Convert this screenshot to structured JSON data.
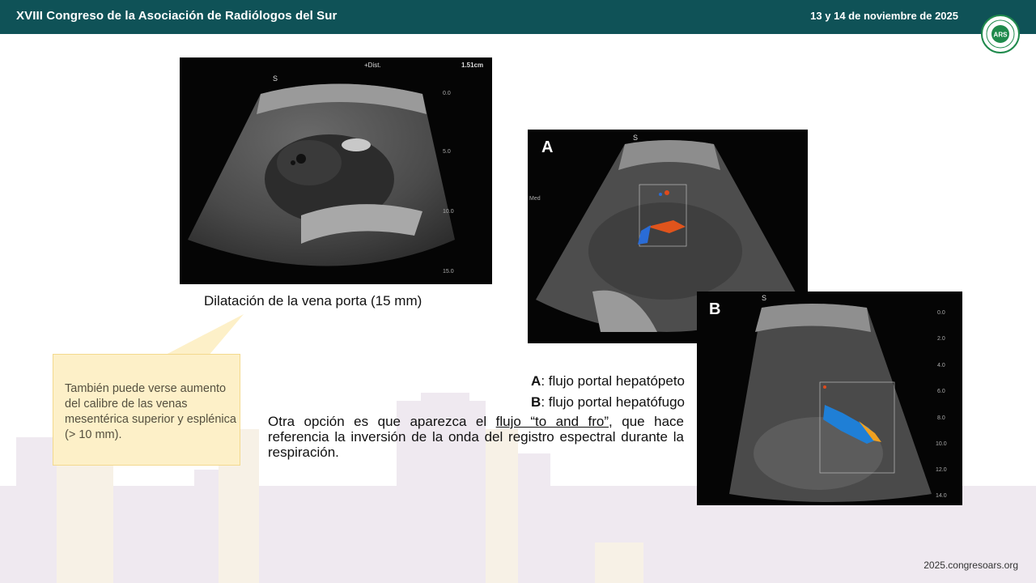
{
  "header": {
    "title": "XVIII Congreso de la Asociación de Radiólogos del Sur",
    "date": "13 y 14 de noviembre de 2025",
    "logo_text": "ARS"
  },
  "images": {
    "portal": {
      "marker_s": "S",
      "dist_label": "+Dist.",
      "dist_value": "1.51cm",
      "depth_ticks": [
        "0.0",
        "5.0",
        "10.0",
        "15.0"
      ]
    },
    "a": {
      "letter": "A",
      "marker_s": "S",
      "side_label": "Med"
    },
    "b": {
      "letter": "B",
      "marker_s": "S",
      "depth_ticks": [
        "0.0",
        "2.0",
        "4.0",
        "6.0",
        "8.0",
        "10.0",
        "12.0",
        "14.0"
      ]
    }
  },
  "caption": "Dilatación de la vena porta (15 mm)",
  "callout": "También puede verse aumento del calibre de las venas mesentérica superior y esplénica (> 10 mm).",
  "legend": {
    "a_key": "A",
    "a_text": ": flujo portal hepatópeto",
    "b_key": "B",
    "b_text": ": flujo portal hepatófugo"
  },
  "body": {
    "before": "Otra opción es que aparezca el ",
    "underlined": "flujo “to and fro”",
    "after": ", que hace referencia la inversión de la onda del registro espectral durante la respiración."
  },
  "footer_url": "2025.congresoars.org",
  "colors": {
    "header_bg": "#0f5257",
    "callout_bg": "#fdf0c8",
    "skyline": "#ece6ee"
  }
}
